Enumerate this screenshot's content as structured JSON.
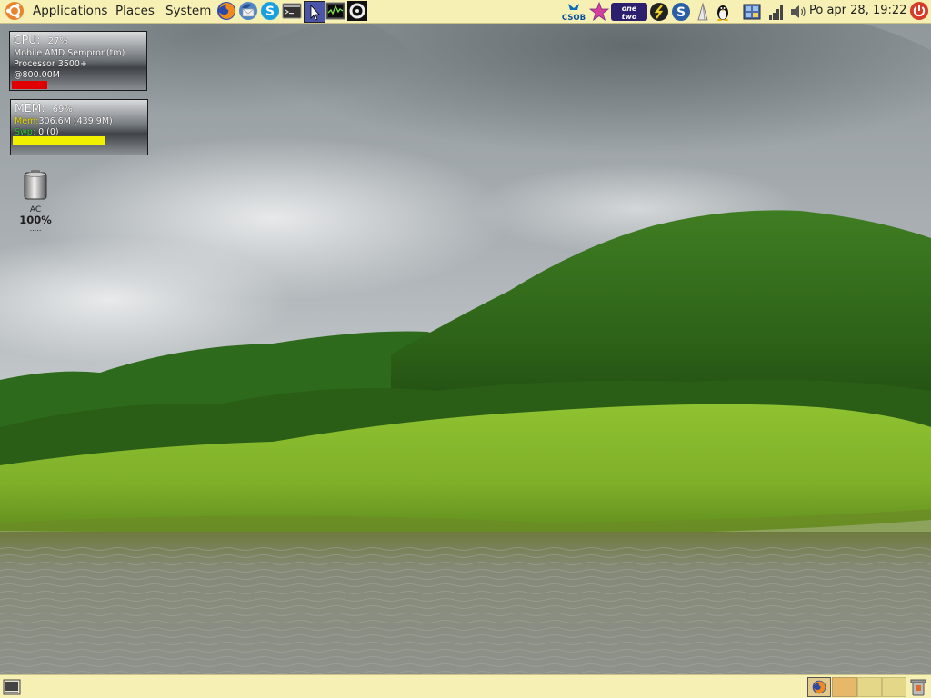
{
  "top_panel": {
    "menus": [
      {
        "id": "applications",
        "label": "Applications"
      },
      {
        "id": "places",
        "label": "Places"
      },
      {
        "id": "system",
        "label": "System"
      }
    ],
    "launchers": [
      "firefox-icon",
      "thunderbird-icon",
      "skype-icon",
      "terminal-icon",
      "pointer-icon",
      "system-monitor-icon",
      "app-launcher-icon"
    ],
    "tray": [
      "csob-icon",
      "star-icon",
      "one-two-icon",
      "network-s-icon",
      "status-s-icon",
      "penguin-icon",
      "tux-icon",
      "updates-icon",
      "wireless-signal-icon",
      "volume-icon"
    ],
    "clock": "Po apr 28, 19:22"
  },
  "cpu": {
    "label": "CPU:",
    "percent": "27%",
    "model_line1": "Mobile AMD Sempron(tm)",
    "model_line2": "Processor 3500+",
    "freq": "@800.00M",
    "usage_fraction": 0.27,
    "bar_color": "#e00000"
  },
  "mem": {
    "label": "MEM:",
    "percent": "69%",
    "mem_prefix": "Mem:",
    "mem_value": "306.6M (439.9M)",
    "swap_prefix": "Swp:",
    "swap_value": "0 (0)",
    "usage_fraction": 0.69,
    "bar_color": "#f0f000",
    "mem_color": "#f0e000",
    "swap_color": "#32c832"
  },
  "battery": {
    "label": "AC",
    "percent": "100%",
    "dots": "....."
  },
  "bottom_panel": {
    "show_desktop": "show-desktop-icon",
    "tasks": [
      "firefox-window-icon"
    ],
    "workspaces": 4,
    "active_workspace": 1
  },
  "colors": {
    "panel_bg": "#f6f0b4",
    "sky": "#b8bec2",
    "hill": "#3d7a20",
    "grass": "#8cbe2c",
    "water": "#7d8272"
  }
}
